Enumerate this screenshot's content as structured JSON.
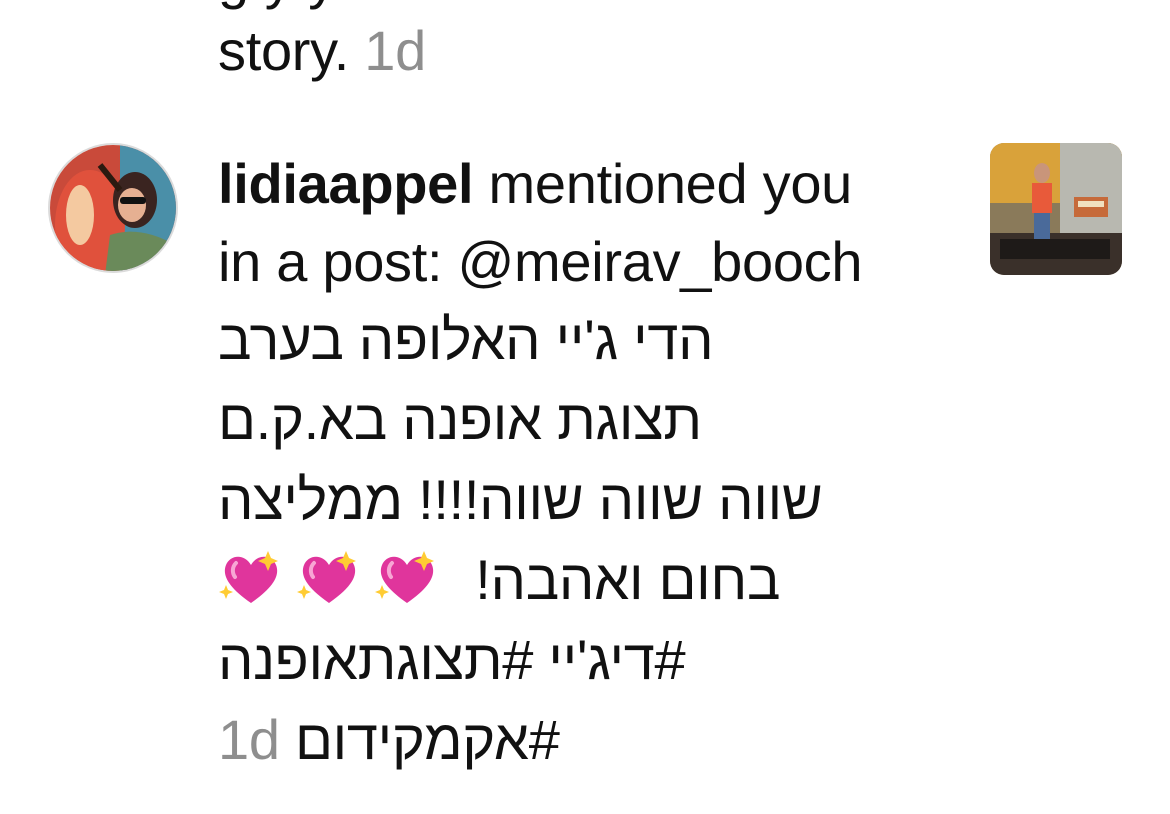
{
  "previous_item": {
    "tail_text": "story.",
    "time": "1d"
  },
  "notification": {
    "username": "lidiaappel",
    "action_line1": " mentioned you",
    "action_line2": "in a post: @meirav_booch",
    "caption_line1": "הדי ג'יי האלופה בערב",
    "caption_line2": "תצוגת אופנה בא.ק.ם",
    "caption_line3": "שווה שווה שווה!!!! ממליצה",
    "caption_line4": "בחום ואהבה!",
    "hashtags_line1": "#דיג'יי #תצוגתאופנה",
    "hashtags_line2": "#אקמקידום",
    "time": "1d",
    "emoji": "sparkling-heart",
    "emoji_count": 3
  },
  "colors": {
    "text": "#111111",
    "timestamp": "#8e8e8e",
    "heart_pink": "#e0359c"
  }
}
